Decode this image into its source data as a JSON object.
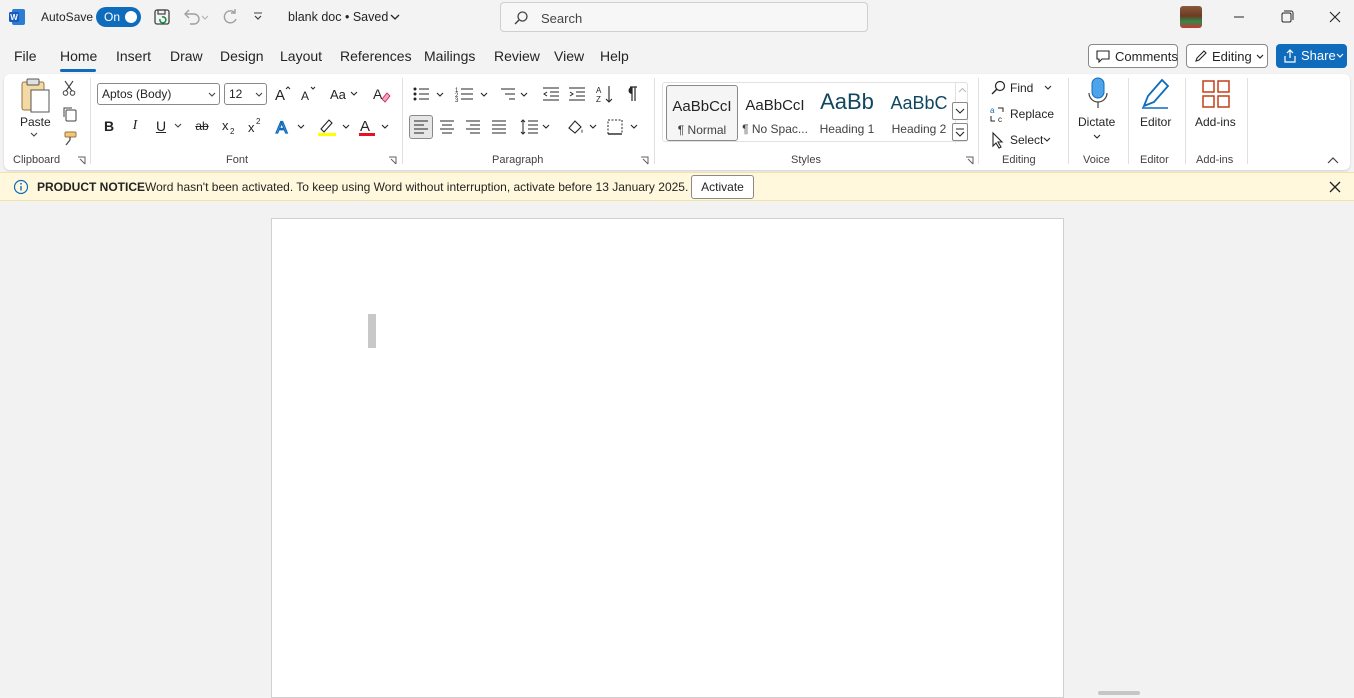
{
  "app": {
    "brand_color": "#0f6cbd",
    "icon": "word-icon"
  },
  "titlebar": {
    "autosave_label": "AutoSave",
    "autosave_state": "On",
    "doc_title": "blank doc • Saved",
    "search_placeholder": "Search"
  },
  "menu": {
    "tabs": [
      "File",
      "Home",
      "Insert",
      "Draw",
      "Design",
      "Layout",
      "References",
      "Mailings",
      "Review",
      "View",
      "Help"
    ],
    "active_tab": "Home",
    "comments_label": "Comments",
    "editing_label": "Editing",
    "share_label": "Share"
  },
  "ribbon": {
    "clipboard": {
      "label": "Clipboard",
      "paste": "Paste"
    },
    "font": {
      "label": "Font",
      "font_name": "Aptos (Body)",
      "font_size": "12",
      "bold": "B",
      "italic": "I",
      "underline": "U",
      "strike": "ab"
    },
    "paragraph": {
      "label": "Paragraph"
    },
    "styles": {
      "label": "Styles",
      "items": [
        {
          "preview": "AaBbCcI",
          "name": "¶ Normal"
        },
        {
          "preview": "AaBbCcI",
          "name": "¶ No Spac..."
        },
        {
          "preview": "AaBb",
          "name": "Heading 1"
        },
        {
          "preview": "AaBbC",
          "name": "Heading 2"
        }
      ]
    },
    "editing": {
      "label": "Editing",
      "find": "Find",
      "replace": "Replace",
      "select": "Select"
    },
    "voice": {
      "label": "Voice",
      "dictate": "Dictate"
    },
    "editor": {
      "label": "Editor",
      "editor": "Editor"
    },
    "addins": {
      "label": "Add-ins",
      "addins": "Add-ins"
    }
  },
  "notice": {
    "title": "PRODUCT NOTICE",
    "message": "Word hasn't been activated. To keep using Word without interruption, activate before 13 January 2025.",
    "button": "Activate"
  }
}
